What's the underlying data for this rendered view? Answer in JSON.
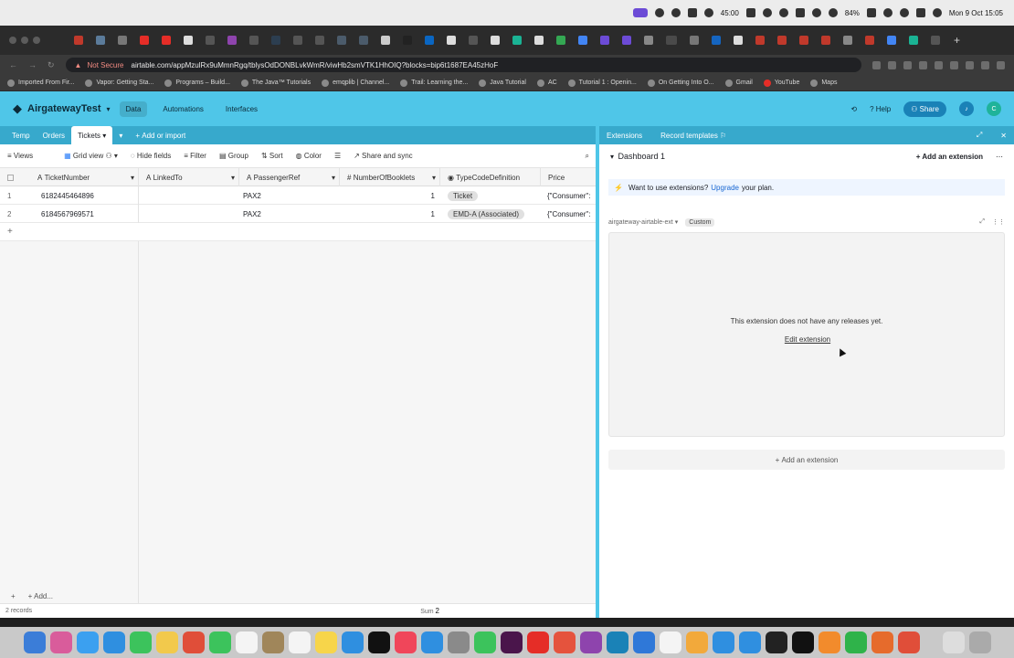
{
  "menubar": {
    "timer": "45:00",
    "battery": "84%",
    "datetime": "Mon 9 Oct  15:05"
  },
  "browser": {
    "not_secure": "Not Secure",
    "url": "airtable.com/appMzulRx9uMmnRgq/tblysOdDONBLvkWmR/viwHb2smVTK1HhOIQ?blocks=bip6t1687EA45zHoF",
    "bookmarks": [
      "Imported From Fir...",
      "Vapor: Getting Sta...",
      "Programs – Build...",
      "The Java™ Tutorials",
      "emqplib | Channel...",
      "Trail: Learning the...",
      "Java Tutorial",
      "AC",
      "Tutorial 1 : Openin...",
      "On Getting Into O...",
      "Gmail",
      "YouTube",
      "Maps"
    ]
  },
  "app": {
    "base_name": "AirgatewayTest",
    "nav": [
      "Data",
      "Automations",
      "Interfaces"
    ],
    "help": "Help",
    "share": "Share",
    "avatar": "C"
  },
  "tables": {
    "tabs": [
      "Temp",
      "Orders",
      "Tickets"
    ],
    "add_or_import": "Add or import"
  },
  "viewbar": {
    "views": "Views",
    "grid_view": "Grid view",
    "hide_fields": "Hide fields",
    "filter": "Filter",
    "group": "Group",
    "sort": "Sort",
    "color": "Color",
    "share_sync": "Share and sync"
  },
  "grid": {
    "columns": [
      "TicketNumber",
      "LinkedTo",
      "PassengerRef",
      "NumberOfBooklets",
      "TypeCodeDefinition",
      "Price"
    ],
    "rows": [
      {
        "num": "1",
        "ticket": "6182445464896",
        "linked": "",
        "passenger": "PAX2",
        "booklets": "1",
        "type": "Ticket",
        "price": "{\"Consumer\":"
      },
      {
        "num": "2",
        "ticket": "6184567969571",
        "linked": "",
        "passenger": "PAX2",
        "booklets": "1",
        "type": "EMD-A (Associated)",
        "price": "{\"Consumer\":"
      }
    ],
    "add_row": "+",
    "records": "2 records",
    "sum_label": "Sum",
    "sum_value": "2",
    "add_label": "Add..."
  },
  "extensions": {
    "tab_extensions": "Extensions",
    "tab_record_templates": "Record templates",
    "dashboard": "Dashboard 1",
    "add_extension": "Add an extension",
    "banner_prefix": "Want to use extensions?",
    "banner_link": "Upgrade",
    "banner_suffix": "your plan.",
    "ext_name": "airgateway-airtable-ext",
    "ext_tag": "Custom",
    "no_releases": "This extension does not have any releases yet.",
    "edit_extension": "Edit extension",
    "add_extension_bottom": "Add an extension"
  }
}
